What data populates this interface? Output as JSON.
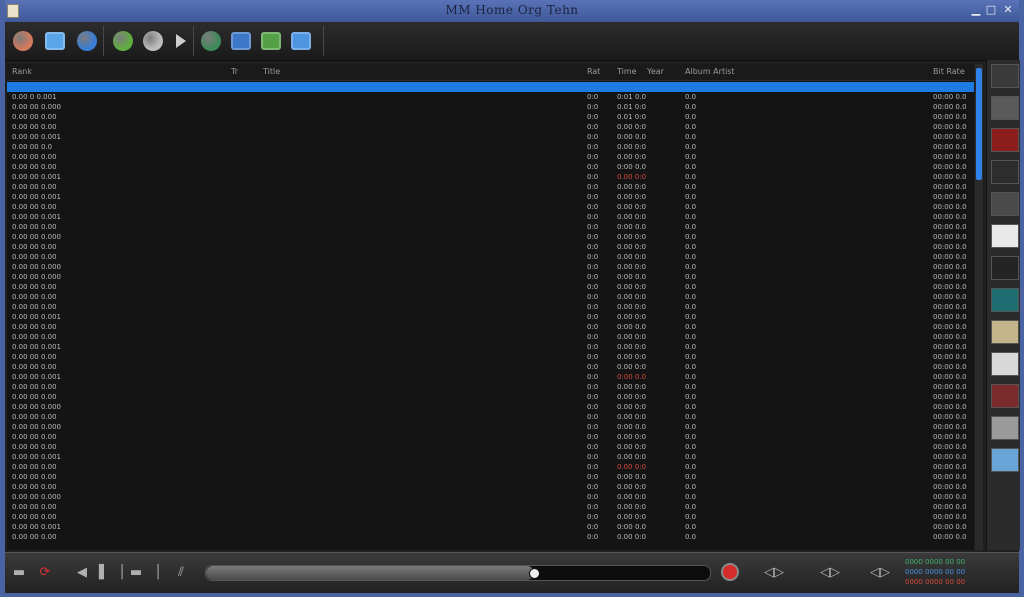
{
  "window": {
    "title": "MM Home Org Tehn",
    "icon": "app-icon",
    "controls": [
      "minimize-icon",
      "maximize-icon",
      "close-icon"
    ]
  },
  "toolbar": {
    "buttons": [
      {
        "name": "avatar-button",
        "icon": "user-icon",
        "color": "#d27a5c"
      },
      {
        "name": "library-button",
        "icon": "library-icon",
        "color": "#5aa4e8"
      },
      {
        "name": "network-button",
        "icon": "network-icon",
        "color": "#3a7dd6"
      },
      {
        "name": "refresh-button",
        "icon": "refresh-icon",
        "color": "#5fae3f"
      },
      {
        "name": "disc-button",
        "icon": "disc-icon",
        "color": "#bdbdbd"
      },
      {
        "name": "play-button",
        "icon": "play-icon",
        "color": "#cfcfcf"
      },
      {
        "name": "globe-button",
        "icon": "globe-icon",
        "color": "#3e8a5a"
      },
      {
        "name": "device-button",
        "icon": "device-icon",
        "color": "#3c77c8"
      },
      {
        "name": "tools-button",
        "icon": "tools-icon",
        "color": "#55a046"
      },
      {
        "name": "calendar-button",
        "icon": "calendar-icon",
        "color": "#4f94df"
      }
    ]
  },
  "list": {
    "headers": [
      "Rank",
      "Tr",
      "Title",
      "Rat",
      "Time",
      "Year",
      "Album Artist",
      "Bit Rate"
    ],
    "rows": [
      {
        "c1": "",
        "c2": "",
        "c3": "",
        "c4": "",
        "c5": "",
        "selected": true
      },
      {
        "c1": "0.00 0 0.001",
        "c2": "0:0",
        "c3": "0:01 0.0",
        "c4": "0.0",
        "c5": "00:00 0.0"
      },
      {
        "c1": "0.00 00 0.000",
        "c2": "0:0",
        "c3": "0.01 0:0",
        "c4": "0.0",
        "c5": "00:00 0.0"
      },
      {
        "c1": "0.00 00 0.00",
        "c2": "0:0",
        "c3": "0.01 0:0",
        "c4": "0.0",
        "c5": "00:00 0.0"
      },
      {
        "c1": "0.00 00 0.00",
        "c2": "0:0",
        "c3": "0.00 0:0",
        "c4": "0.0",
        "c5": "00:00 0.0"
      },
      {
        "c1": "0.00 00 0.001",
        "c2": "0:0",
        "c3": "0:00 0.0",
        "c4": "0.0",
        "c5": "00:00 0.0"
      },
      {
        "c1": "0.00 00 0.0",
        "c2": "0:0",
        "c3": "0.00 0:0",
        "c4": "0.0",
        "c5": "00:00 0.0"
      },
      {
        "c1": "0.00 00 0.00",
        "c2": "0:0",
        "c3": "0.00 0:0",
        "c4": "0.0",
        "c5": "00:00 0.0"
      },
      {
        "c1": "0.00 00 0.00",
        "c2": "0:0",
        "c3": "0:00 0.0",
        "c4": "0.0",
        "c5": "00:00 0.0"
      },
      {
        "c1": "0.00 00 0.001",
        "c2": "0:0",
        "c3": "0.00 0:0",
        "c4": "0.0",
        "c5": "00:00 0.0",
        "red": true
      },
      {
        "c1": "0.00 00 0.00",
        "c2": "0:0",
        "c3": "0.00 0:0",
        "c4": "0.0",
        "c5": "00:00 0.0"
      },
      {
        "c1": "0.00 00 0.001",
        "c2": "0:0",
        "c3": "0.00 0:0",
        "c4": "0.0",
        "c5": "00:00 0.0"
      },
      {
        "c1": "0.00 00 0.00",
        "c2": "0:0",
        "c3": "0.00 0:0",
        "c4": "0.0",
        "c5": "00:00 0.0"
      },
      {
        "c1": "0.00 00 0.001",
        "c2": "0:0",
        "c3": "0.00 0:0",
        "c4": "0.0",
        "c5": "00:00 0.0"
      },
      {
        "c1": "0.00 00 0.00",
        "c2": "0:0",
        "c3": "0:00 0.0",
        "c4": "0.0",
        "c5": "00:00 0.0"
      },
      {
        "c1": "0.00 00 0.000",
        "c2": "0:0",
        "c3": "0.00 0:0",
        "c4": "0.0",
        "c5": "00:00 0.0"
      },
      {
        "c1": "0.00 00 0.00",
        "c2": "0:0",
        "c3": "0.00 0:0",
        "c4": "0.0",
        "c5": "00:00 0.0"
      },
      {
        "c1": "0.00 00 0.00",
        "c2": "0:0",
        "c3": "0.00 0:0",
        "c4": "0.0",
        "c5": "00:00 0.0"
      },
      {
        "c1": "0.00 00 0.000",
        "c2": "0:0",
        "c3": "0.00 0:0",
        "c4": "0.0",
        "c5": "00:00 0.0"
      },
      {
        "c1": "0.00 00 0.000",
        "c2": "0:0",
        "c3": "0:00 0.0",
        "c4": "0.0",
        "c5": "00:00 0.0"
      },
      {
        "c1": "0.00 00 0.00",
        "c2": "0:0",
        "c3": "0.00 0:0",
        "c4": "0.0",
        "c5": "00:00 0.0"
      },
      {
        "c1": "0.00 00 0.00",
        "c2": "0:0",
        "c3": "0.00 0:0",
        "c4": "0.0",
        "c5": "00:00 0.0"
      },
      {
        "c1": "0.00 00 0.00",
        "c2": "0:0",
        "c3": "0.00 0:0",
        "c4": "0.0",
        "c5": "00:00 0.0"
      },
      {
        "c1": "0.00 00 0.001",
        "c2": "0:0",
        "c3": "0.00 0:0",
        "c4": "0.0",
        "c5": "00:00 0.0"
      },
      {
        "c1": "0.00 00 0.00",
        "c2": "0:0",
        "c3": "0:00 0.0",
        "c4": "0.0",
        "c5": "00:00 0.0"
      },
      {
        "c1": "0.00 00 0.00",
        "c2": "0:0",
        "c3": "0.00 0:0",
        "c4": "0.0",
        "c5": "00:00 0.0"
      },
      {
        "c1": "0.00 00 0.001",
        "c2": "0:0",
        "c3": "0.00 0:0",
        "c4": "0.0",
        "c5": "00:00 0.0"
      },
      {
        "c1": "0.00 00 0.00",
        "c2": "0:0",
        "c3": "0.00 0:0",
        "c4": "0.0",
        "c5": "00:00 0.0"
      },
      {
        "c1": "0.00 00 0.00",
        "c2": "0:0",
        "c3": "0.00 0:0",
        "c4": "0.0",
        "c5": "00:00 0.0"
      },
      {
        "c1": "0.00 00 0.001",
        "c2": "0:0",
        "c3": "0:00 0.0",
        "c4": "0.0",
        "c5": "00:00 0.0",
        "red": true
      },
      {
        "c1": "0.00 00 0.00",
        "c2": "0:0",
        "c3": "0.00 0:0",
        "c4": "0.0",
        "c5": "00:00 0.0"
      },
      {
        "c1": "0.00 00 0.00",
        "c2": "0:0",
        "c3": "0.00 0:0",
        "c4": "0.0",
        "c5": "00:00 0.0"
      },
      {
        "c1": "0.00 00 0.000",
        "c2": "0:0",
        "c3": "0.00 0:0",
        "c4": "0.0",
        "c5": "00:00 0.0"
      },
      {
        "c1": "0.00 00 0.00",
        "c2": "0:0",
        "c3": "0.00 0:0",
        "c4": "0.0",
        "c5": "00:00 0.0"
      },
      {
        "c1": "0.00 00 0.000",
        "c2": "0:0",
        "c3": "0:00 0.0",
        "c4": "0.0",
        "c5": "00:00 0.0"
      },
      {
        "c1": "0.00 00 0.00",
        "c2": "0:0",
        "c3": "0.00 0:0",
        "c4": "0.0",
        "c5": "00:00 0.0"
      },
      {
        "c1": "0.00 00 0.00",
        "c2": "0:0",
        "c3": "0.00 0:0",
        "c4": "0.0",
        "c5": "00:00 0.0"
      },
      {
        "c1": "0.00 00 0.001",
        "c2": "0:0",
        "c3": "0.00 0:0",
        "c4": "0.0",
        "c5": "00:00 0.0"
      },
      {
        "c1": "0.00 00 0.00",
        "c2": "0:0",
        "c3": "0.00 0:0",
        "c4": "0.0",
        "c5": "00:00 0.0",
        "red": true
      },
      {
        "c1": "0.00 00 0.00",
        "c2": "0:0",
        "c3": "0:00 0.0",
        "c4": "0.0",
        "c5": "00:00 0.0"
      },
      {
        "c1": "0.00 00 0.00",
        "c2": "0:0",
        "c3": "0.00 0:0",
        "c4": "0.0",
        "c5": "00:00 0.0"
      },
      {
        "c1": "0.00 00 0.000",
        "c2": "0:0",
        "c3": "0.00 0:0",
        "c4": "0.0",
        "c5": "00:00 0.0"
      },
      {
        "c1": "0.00 00 0.00",
        "c2": "0:0",
        "c3": "0.00 0:0",
        "c4": "0.0",
        "c5": "00:00 0.0"
      },
      {
        "c1": "0.00 00 0.00",
        "c2": "0:0",
        "c3": "0.00 0:0",
        "c4": "0.0",
        "c5": "00:00 0.0"
      },
      {
        "c1": "0.00 00 0.001",
        "c2": "0:0",
        "c3": "0:00 0.0",
        "c4": "0.0",
        "c5": "00:00 0.0"
      },
      {
        "c1": "0.00 00 0.00",
        "c2": "0:0",
        "c3": "0.00 0:0",
        "c4": "0.0",
        "c5": "00:00 0.0"
      }
    ]
  },
  "art_strip": {
    "thumbs": [
      "#3a3a3a",
      "#5a5a5a",
      "#8b1d1d",
      "#2d2d2d",
      "#4a4a4a",
      "#e8e8e8",
      "#242424",
      "#1e6d73",
      "#c4b68a",
      "#d8d8d8",
      "#7a2a2a",
      "#9a9a9a",
      "#6aa5d8"
    ]
  },
  "transport": {
    "seek": 0.65,
    "time_label": "",
    "status_lines": [
      "0000 0000 00 00",
      "0000 0000 00 00",
      "0000 0000 00 00"
    ]
  },
  "colors": {
    "accent": "#1e7be4",
    "record": "#d62b2b"
  }
}
